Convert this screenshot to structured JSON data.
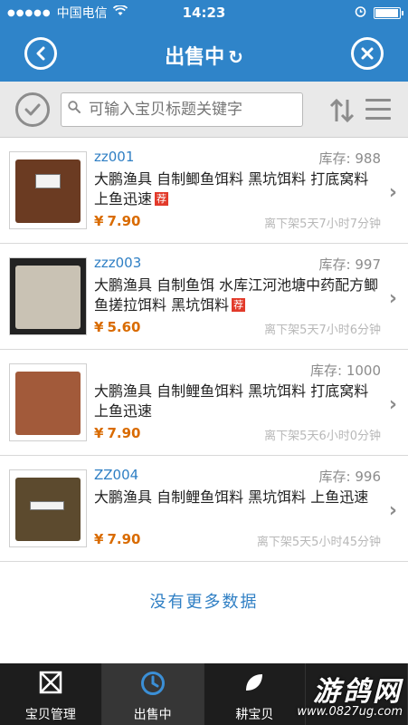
{
  "status_bar": {
    "signal": "●●●●●",
    "carrier": "中国电信",
    "wifi": "wifi-icon",
    "time": "14:23",
    "alarm": "alarm-icon"
  },
  "nav": {
    "title": "出售中",
    "back_icon": "back-icon",
    "close_icon": "close-icon",
    "refresh_icon": "refresh-icon"
  },
  "search": {
    "placeholder": "可输入宝贝标题关键字"
  },
  "items": [
    {
      "code": "zz001",
      "stock_label": "库存:",
      "stock": "988",
      "title": "大鹏渔具 自制鲫鱼饵料 黑坑饵料 打底窝料 上鱼迅速",
      "recommended": "荐",
      "currency": "¥",
      "price": "7.90",
      "delist": "离下架5天7小时7分钟",
      "thumb_color": "#6b3b22"
    },
    {
      "code": "zzz003",
      "stock_label": "库存:",
      "stock": "997",
      "title": "大鹏渔具 自制鱼饵 水库江河池塘中药配方鲫鱼搓拉饵料 黑坑饵料",
      "recommended": "荐",
      "currency": "¥",
      "price": "5.60",
      "delist": "离下架5天7小时6分钟",
      "thumb_color": "#c9c2b4"
    },
    {
      "code": "",
      "stock_label": "库存:",
      "stock": "1000",
      "title": "大鹏渔具 自制鲤鱼饵料 黑坑饵料 打底窝料 上鱼迅速",
      "recommended": "",
      "currency": "¥",
      "price": "7.90",
      "delist": "离下架5天6小时0分钟",
      "thumb_color": "#a25a3a"
    },
    {
      "code": "ZZ004",
      "stock_label": "库存:",
      "stock": "996",
      "title": "大鹏渔具 自制鲤鱼饵料 黑坑饵料 上鱼迅速",
      "recommended": "",
      "currency": "¥",
      "price": "7.90",
      "delist": "离下架5天5小时45分钟",
      "thumb_color": "#5c4a2e"
    }
  ],
  "no_more": "没有更多数据",
  "tabs": [
    {
      "label": "宝贝管理",
      "icon": "box-icon"
    },
    {
      "label": "出售中",
      "icon": "clock-icon"
    },
    {
      "label": "耕宝贝",
      "icon": "leaf-icon"
    },
    {
      "label": "",
      "icon": "more-icon"
    }
  ],
  "watermark": {
    "line1": "游鸽网",
    "line2": "www.0827ug.com"
  },
  "colors": {
    "accent": "#2f84c9",
    "price": "#d96b00",
    "link": "#2f7fc4"
  }
}
